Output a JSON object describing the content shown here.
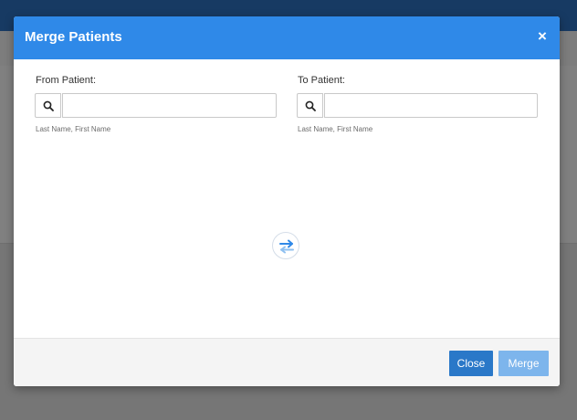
{
  "modal": {
    "title": "Merge Patients",
    "close_glyph": "×"
  },
  "from_patient": {
    "label": "From Patient:",
    "value": "",
    "placeholder": "",
    "hint": "Last Name, First Name"
  },
  "to_patient": {
    "label": "To Patient:",
    "value": "",
    "placeholder": "",
    "hint": "Last Name, First Name"
  },
  "icons": {
    "search": "search-icon",
    "swap": "swap-arrows-icon",
    "close": "close-icon"
  },
  "footer": {
    "close_label": "Close",
    "merge_label": "Merge"
  },
  "colors": {
    "header": "#2f89e8",
    "primary_button": "#2a78c8",
    "disabled_button": "#7db5ec",
    "app_topbar": "#173a63"
  }
}
